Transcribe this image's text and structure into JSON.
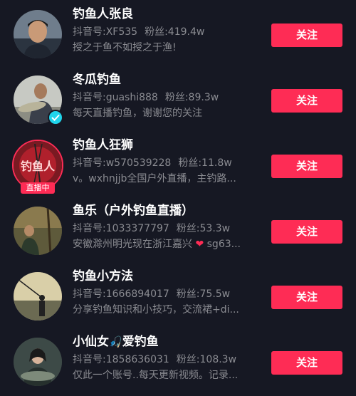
{
  "users": [
    {
      "name": "钓鱼人张良",
      "id_label": "抖音号:XF535",
      "fans_label": "粉丝:419.4w",
      "desc": "授之于鱼不如授之于渔!",
      "follow_label": "关注"
    },
    {
      "name": "冬瓜钓鱼",
      "id_label": "抖音号:guashi888",
      "fans_label": "粉丝:89.3w",
      "desc": "每天直播钓鱼，谢谢您的关注",
      "follow_label": "关注"
    },
    {
      "name": "钓鱼人狂狮",
      "id_label": "抖音号:w570539228",
      "fans_label": "粉丝:11.8w",
      "desc": "v。wxhnjjb全国户外直播，主钓路...",
      "follow_label": "关注",
      "live_label": "直播中",
      "avatar_text": "钓鱼人"
    },
    {
      "name": "鱼乐（户外钓鱼直播）",
      "id_label": "抖音号:1033377797",
      "fans_label": "粉丝:53.3w",
      "desc": "安徽滁州明光现在浙江嘉兴",
      "desc_tail": "sg63...",
      "follow_label": "关注"
    },
    {
      "name": "钓鱼小方法",
      "id_label": "抖音号:1666894017",
      "fans_label": "粉丝:75.5w",
      "desc": "分享钓鱼知识和小技巧，交流裙+di...",
      "follow_label": "关注"
    },
    {
      "name_a": "小仙女",
      "name_b": "爱钓鱼",
      "id_label": "抖音号:1858636031",
      "fans_label": "粉丝:108.3w",
      "desc": "仅此一个账号..每天更新视频。记录...",
      "follow_label": "关注"
    }
  ],
  "colors": {
    "background": "#161823",
    "accent": "#fe2c55",
    "secondary_text": "#8a8b91",
    "verified": "#20d5ec"
  }
}
